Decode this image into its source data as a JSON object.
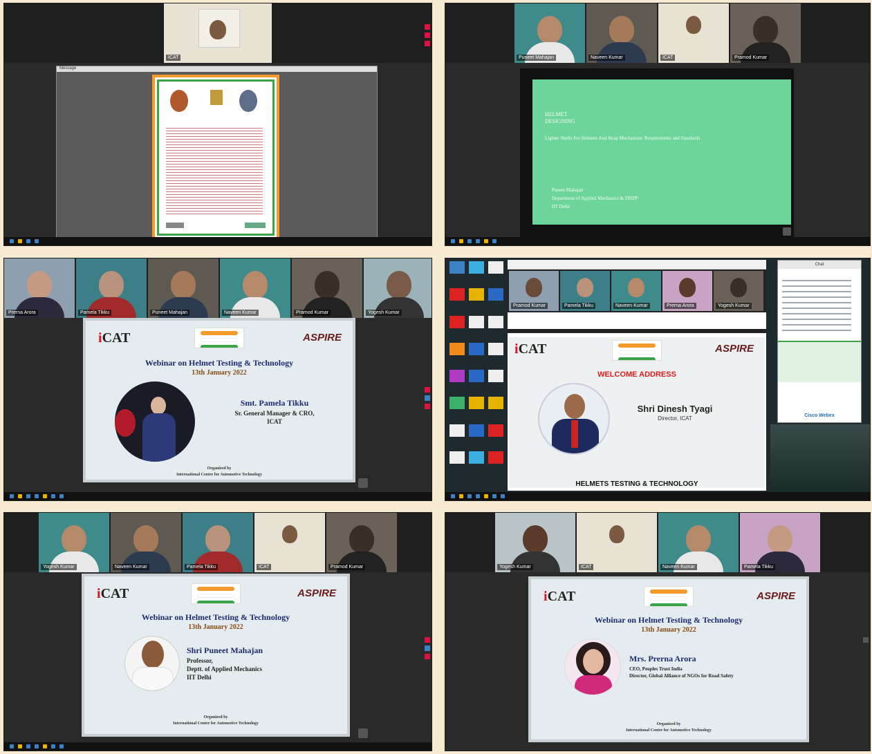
{
  "colors": {
    "background": "#f7ead2",
    "accent_red": "#d12",
    "title_blue": "#1d2a6e",
    "green_slide": "#6dd49a"
  },
  "panel1": {
    "participants": [
      {
        "name": "ICAT"
      }
    ],
    "doc_viewer": {
      "header": "Message"
    }
  },
  "panel2": {
    "participants": [
      {
        "name": "Puneet Mahajan"
      },
      {
        "name": "Naveen Kumar"
      },
      {
        "name": "ICAT"
      },
      {
        "name": "Pramod Kumar"
      }
    ],
    "slide": {
      "heading": "HELMET DESIGNING",
      "subtitle": "Lighter Shells For Helmets And Strap Mechanism: Requirements and Standards",
      "presenter": "Puneet Mahajan",
      "department": "Department of Applied Mechanics & TRIPP",
      "institute": "IIT Delhi"
    }
  },
  "panel3": {
    "participants": [
      {
        "name": "Prerna Arora"
      },
      {
        "name": "Pamela Tikku"
      },
      {
        "name": "Puneet Mahajan"
      },
      {
        "name": "Naveen Kumar"
      },
      {
        "name": "Pramod Kumar"
      },
      {
        "name": "Yogesh Kumar"
      }
    ],
    "slide": {
      "title": "Webinar on Helmet Testing & Technology",
      "date": "13th January 2022",
      "speaker_name": "Smt. Pamela Tikku",
      "designation_line1": "Sr. General Manager & CRO,",
      "designation_line2": "ICAT",
      "organized_by": "Organized by",
      "organizer": "International Centre for Automotive Technology"
    }
  },
  "panel4": {
    "participants": [
      {
        "name": "Pramod Kumar"
      },
      {
        "name": "Pamela Tikku"
      },
      {
        "name": "Naveen Kumar"
      },
      {
        "name": "Prerna Arora"
      },
      {
        "name": "Yogesh Kumar"
      }
    ],
    "slide": {
      "banner": "WELCOME ADDRESS",
      "speaker_name": "Shri Dinesh Tyagi",
      "designation": "Director, ICAT",
      "footer": "HELMETS TESTING & TECHNOLOGY"
    },
    "chat": {
      "title": "Chat",
      "footer": "Cisco Webex"
    }
  },
  "panel5": {
    "participants": [
      {
        "name": "Yogesh Kumar"
      },
      {
        "name": "Naveen Kumar"
      },
      {
        "name": "Pamela Tikku"
      },
      {
        "name": "ICAT"
      },
      {
        "name": "Pramod Kumar"
      }
    ],
    "slide": {
      "title": "Webinar on Helmet Testing & Technology",
      "date": "13th January 2022",
      "speaker_name": "Shri Puneet Mahajan",
      "line1": "Professor,",
      "line2": "Deptt. of Applied Mechanics",
      "line3": "IIT Delhi",
      "organized_by": "Organized by",
      "organizer": "International Centre for Automotive Technology"
    }
  },
  "panel6": {
    "participants": [
      {
        "name": "Yogesh Kumar"
      },
      {
        "name": "ICAT"
      },
      {
        "name": "Naveen Kumar"
      },
      {
        "name": "Pamela Tikku"
      }
    ],
    "slide": {
      "title": "Webinar on Helmet Testing & Technology",
      "date": "13th January 2022",
      "speaker_name": "Mrs. Prerna Arora",
      "line1": "CEO, Peoples Trust India",
      "line2": "Director, Global Alliance of NGOs for Road Safety",
      "organized_by": "Organized by",
      "organizer": "International Centre for Automotive Technology"
    }
  }
}
